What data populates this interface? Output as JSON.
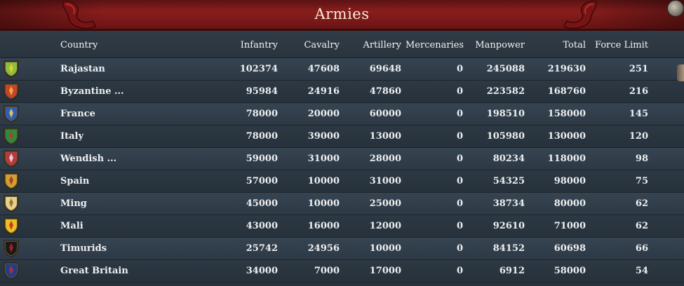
{
  "window": {
    "title": "Armies"
  },
  "columns": {
    "country": "Country",
    "infantry": "Infantry",
    "cavalry": "Cavalry",
    "artillery": "Artillery",
    "mercenaries": "Mercenaries",
    "manpower": "Manpower",
    "total": "Total",
    "force_limit": "Force Limit"
  },
  "rows": [
    {
      "country": "Rajastan",
      "infantry": "102374",
      "cavalry": "47608",
      "artillery": "69648",
      "mercenaries": "0",
      "manpower": "245088",
      "total": "219630",
      "force_limit": "251",
      "flag_icon": "rajastan-flag-icon",
      "flag_color": "#8fbf3a",
      "flag_accent": "#e7d040"
    },
    {
      "country": "Byzantine ...",
      "infantry": "95984",
      "cavalry": "24916",
      "artillery": "47860",
      "mercenaries": "0",
      "manpower": "223582",
      "total": "168760",
      "force_limit": "216",
      "flag_icon": "byzantine-flag-icon",
      "flag_color": "#c8432c",
      "flag_accent": "#f0c040"
    },
    {
      "country": "France",
      "infantry": "78000",
      "cavalry": "20000",
      "artillery": "60000",
      "mercenaries": "0",
      "manpower": "198510",
      "total": "158000",
      "force_limit": "145",
      "flag_icon": "france-flag-icon",
      "flag_color": "#2f5fb0",
      "flag_accent": "#f0d060"
    },
    {
      "country": "Italy",
      "infantry": "78000",
      "cavalry": "39000",
      "artillery": "13000",
      "mercenaries": "0",
      "manpower": "105980",
      "total": "130000",
      "force_limit": "120",
      "flag_icon": "italy-flag-icon",
      "flag_color": "#2c8a3a",
      "flag_accent": "#c83030"
    },
    {
      "country": "Wendish  ...",
      "infantry": "59000",
      "cavalry": "31000",
      "artillery": "28000",
      "mercenaries": "0",
      "manpower": "80234",
      "total": "118000",
      "force_limit": "98",
      "flag_icon": "wendish-flag-icon",
      "flag_color": "#b83a3a",
      "flag_accent": "#e8e8e8"
    },
    {
      "country": "Spain",
      "infantry": "57000",
      "cavalry": "10000",
      "artillery": "31000",
      "mercenaries": "0",
      "manpower": "54325",
      "total": "98000",
      "force_limit": "75",
      "flag_icon": "spain-flag-icon",
      "flag_color": "#d0a030",
      "flag_accent": "#b02828"
    },
    {
      "country": "Ming",
      "infantry": "45000",
      "cavalry": "10000",
      "artillery": "25000",
      "mercenaries": "0",
      "manpower": "38734",
      "total": "80000",
      "force_limit": "62",
      "flag_icon": "ming-flag-icon",
      "flag_color": "#e6d08a",
      "flag_accent": "#8a6a2a"
    },
    {
      "country": "Mali",
      "infantry": "43000",
      "cavalry": "16000",
      "artillery": "12000",
      "mercenaries": "0",
      "manpower": "92610",
      "total": "71000",
      "force_limit": "62",
      "flag_icon": "mali-flag-icon",
      "flag_color": "#e8c020",
      "flag_accent": "#c82020"
    },
    {
      "country": "Timurids",
      "infantry": "25742",
      "cavalry": "24956",
      "artillery": "10000",
      "mercenaries": "0",
      "manpower": "84152",
      "total": "60698",
      "force_limit": "66",
      "flag_icon": "timurids-flag-icon",
      "flag_color": "#1a1a1a",
      "flag_accent": "#c02020"
    },
    {
      "country": "Great Britain",
      "infantry": "34000",
      "cavalry": "7000",
      "artillery": "17000",
      "mercenaries": "0",
      "manpower": "6912",
      "total": "58000",
      "force_limit": "54",
      "flag_icon": "great-britain-flag-icon",
      "flag_color": "#1f3f8a",
      "flag_accent": "#d02828"
    }
  ]
}
